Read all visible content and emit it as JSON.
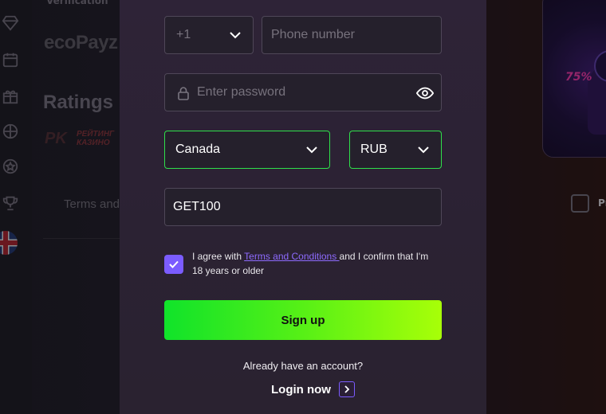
{
  "background": {
    "verification_text": "Verification",
    "ecopayz_logo": "ecoPayz",
    "ratings_heading": "Ratings",
    "rk_logo": "PK",
    "rk_text_line1": "РЕЙТИНГ",
    "rk_text_line2": "КАЗИНО",
    "terms_link": "Terms and",
    "promo_percent": "75%",
    "right_checkbox_label": "Pr"
  },
  "form": {
    "phone_code": "+1",
    "phone_placeholder": "Phone number",
    "password_placeholder": "Enter password",
    "country": "Canada",
    "currency": "RUB",
    "promo_code": "GET100",
    "agree_prefix": "I agree with ",
    "terms_link": "Terms and Conditions ",
    "agree_suffix": "and I confirm that I'm 18 years or older",
    "signup_label": "Sign up",
    "already_text": "Already have an account?",
    "login_label": "Login now"
  },
  "colors": {
    "accent_green": "#2fe04a",
    "accent_purple": "#7b5cff",
    "button_gradient_start": "#10e32a",
    "button_gradient_end": "#a8ff08"
  },
  "icons": [
    "diamond-icon",
    "calendar-icon",
    "gift-icon",
    "sports-icon",
    "star-badge-icon",
    "trophy-icon",
    "uk-flag-icon",
    "chevron-down-icon",
    "lock-icon",
    "eye-icon",
    "check-icon",
    "chevron-right-icon"
  ]
}
